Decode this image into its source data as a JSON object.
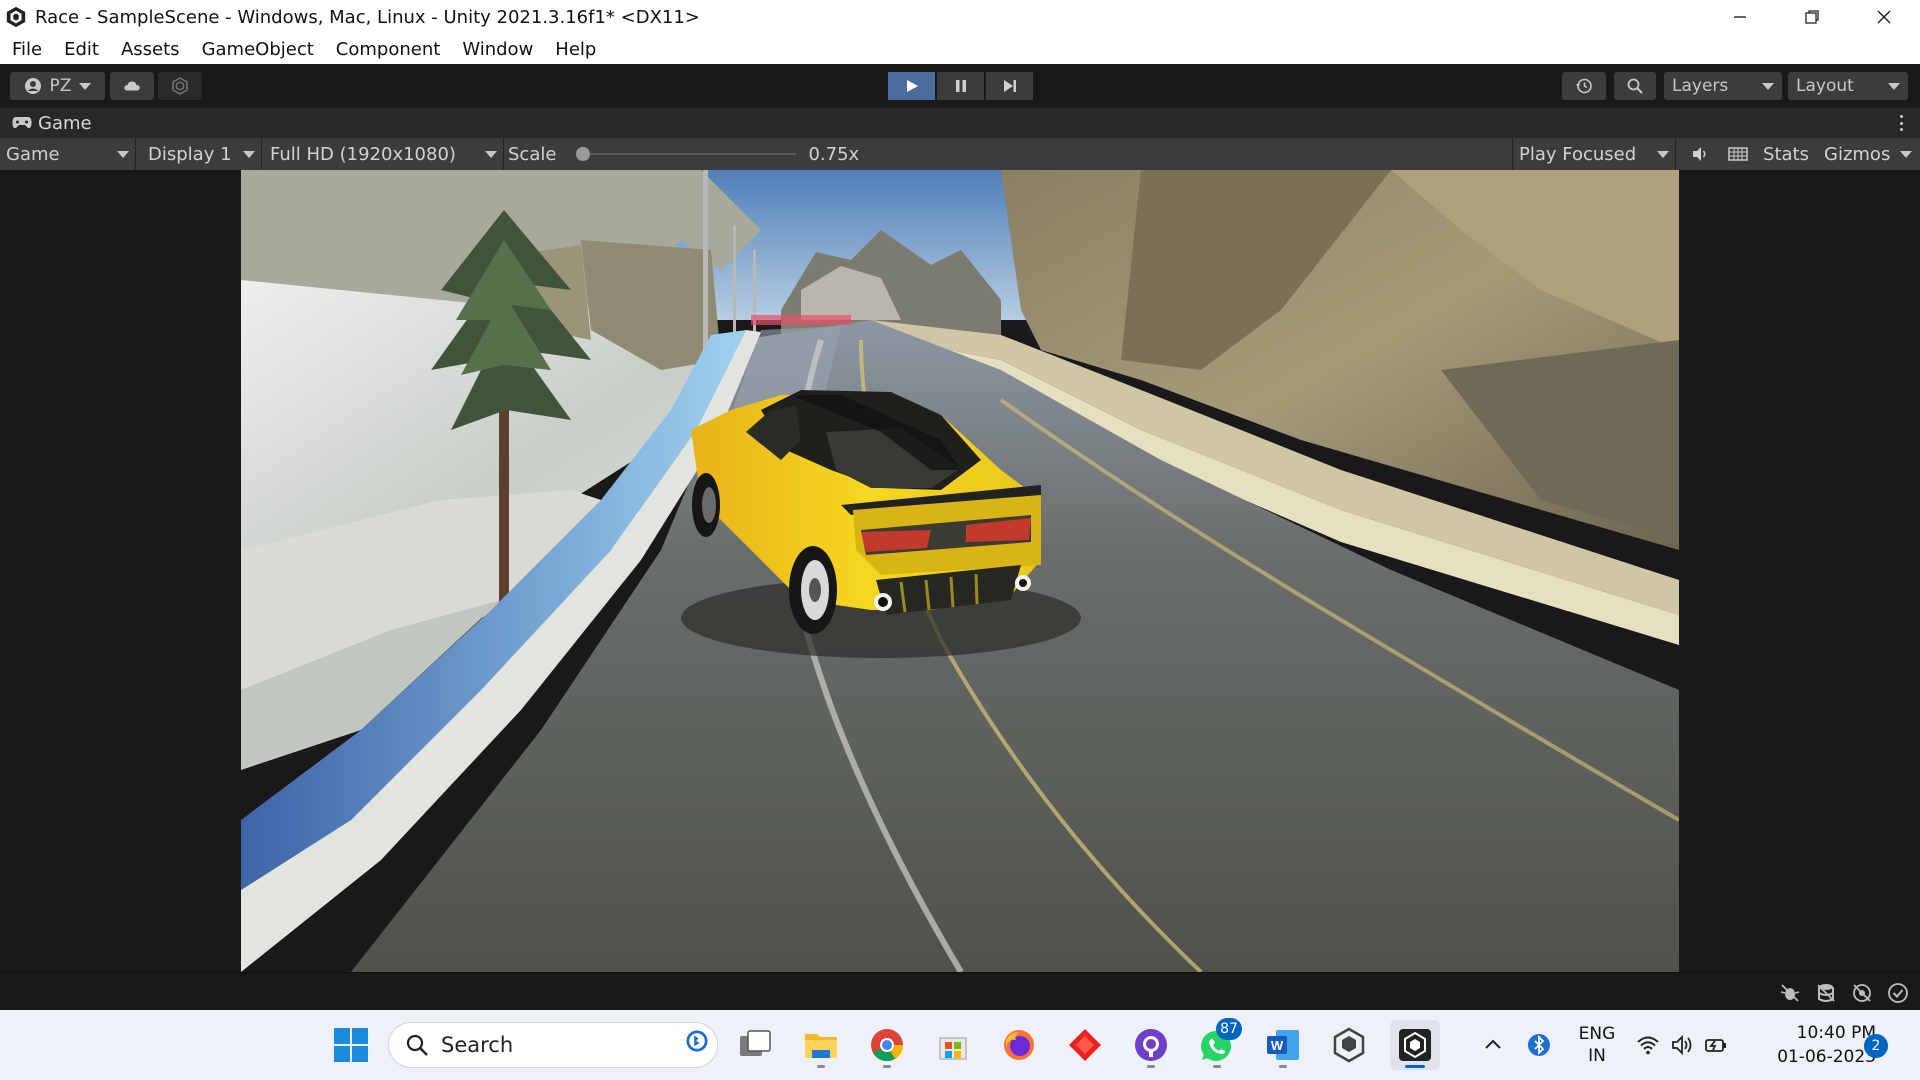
{
  "window": {
    "title": "Race - SampleScene - Windows, Mac, Linux - Unity 2021.3.16f1* <DX11>"
  },
  "menu": [
    "File",
    "Edit",
    "Assets",
    "GameObject",
    "Component",
    "Window",
    "Help"
  ],
  "toolbar": {
    "account_label": "PZ",
    "layers_label": "Layers",
    "layout_label": "Layout",
    "play_state": "playing"
  },
  "game_tab": {
    "label": "Game"
  },
  "game_toolbar": {
    "mode": "Game",
    "display": "Display 1",
    "resolution": "Full HD (1920x1080)",
    "scale_label": "Scale",
    "scale_value": "0.75x",
    "scale_fraction": 0.0,
    "play_focus": "Play Focused",
    "stats_label": "Stats",
    "gizmos_label": "Gizmos"
  },
  "taskbar": {
    "search_placeholder": "Search",
    "apps": [
      "start-icon",
      "search",
      "task-view-icon",
      "file-explorer-icon",
      "chrome-icon",
      "microsoft-store-icon",
      "firefox-icon",
      "git-icon",
      "github-desktop-icon",
      "whatsapp-icon",
      "word-icon",
      "unity-hub-icon",
      "unity-icon"
    ],
    "whatsapp_badge": "87",
    "language_line1": "ENG",
    "language_line2": "IN",
    "time": "10:40 PM",
    "date": "01-06-2023",
    "notifications": "2"
  },
  "colors": {
    "accent": "#4a6d9c",
    "editor_bg": "#191919",
    "taskbar_accent": "#0067c0",
    "car": "#f2d21a"
  }
}
